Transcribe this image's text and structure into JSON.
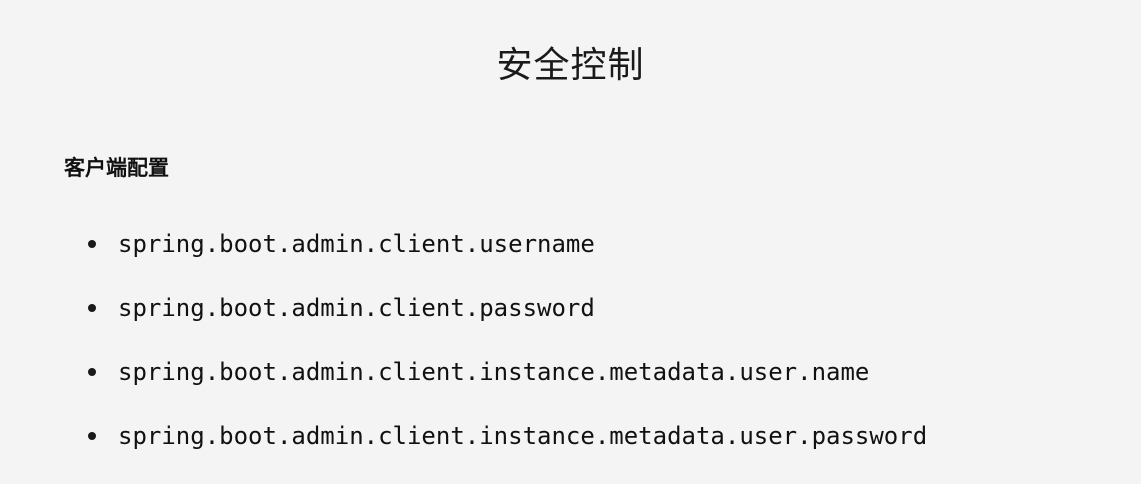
{
  "slide": {
    "title": "安全控制",
    "section_heading": "客户端配置",
    "bullets": [
      "spring.boot.admin.client.username",
      "spring.boot.admin.client.password",
      "spring.boot.admin.client.instance.metadata.user.name",
      "spring.boot.admin.client.instance.metadata.user.password"
    ]
  }
}
